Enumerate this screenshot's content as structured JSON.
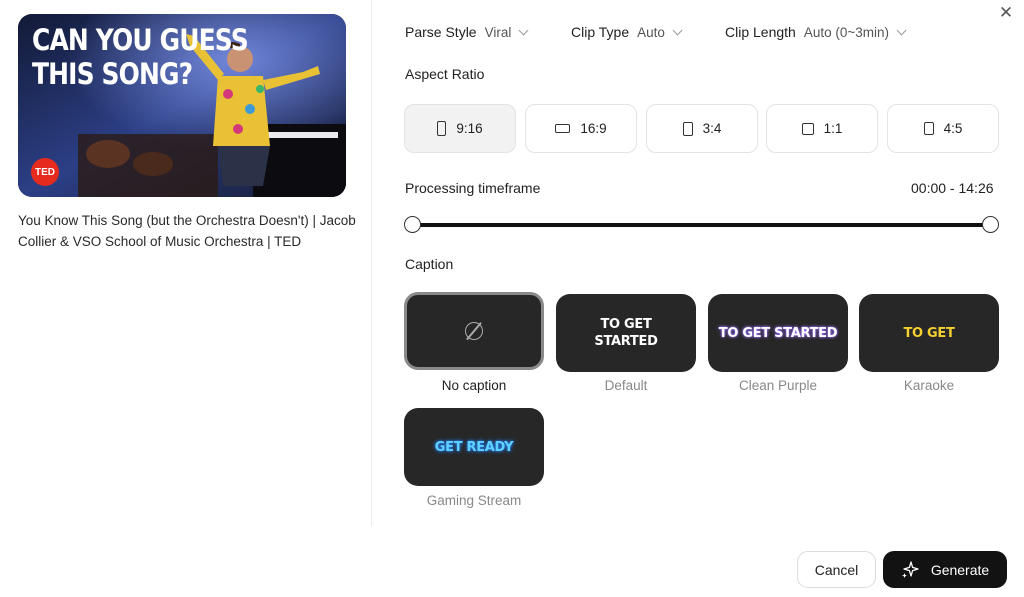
{
  "video": {
    "thumbnail_line1": "CAN YOU GUESS",
    "thumbnail_line2": "THIS SONG?",
    "badge": "TED",
    "title": "You Know This Song (but the Orchestra Doesn't) | Jacob Collier & VSO School of Music Orchestra | TED"
  },
  "params": {
    "parse_style": {
      "label": "Parse Style",
      "value": "Viral"
    },
    "clip_type": {
      "label": "Clip Type",
      "value": "Auto"
    },
    "clip_length": {
      "label": "Clip Length",
      "value": "Auto (0~3min)"
    }
  },
  "aspect": {
    "label": "Aspect Ratio",
    "options": [
      {
        "label": "9:16",
        "selected": true
      },
      {
        "label": "16:9",
        "selected": false
      },
      {
        "label": "3:4",
        "selected": false
      },
      {
        "label": "1:1",
        "selected": false
      },
      {
        "label": "4:5",
        "selected": false
      }
    ]
  },
  "timeframe": {
    "label": "Processing timeframe",
    "range": "00:00 - 14:26",
    "start_fraction": 0,
    "end_fraction": 1
  },
  "caption": {
    "label": "Caption",
    "styles": [
      {
        "name": "No caption",
        "preview": "",
        "selected": true
      },
      {
        "name": "Default",
        "preview": "TO GET STARTED",
        "selected": false
      },
      {
        "name": "Clean Purple",
        "preview": "TO GET STARTED",
        "selected": false
      },
      {
        "name": "Karaoke",
        "preview": "TO GET",
        "selected": false
      },
      {
        "name": "Gaming Stream",
        "preview": "GET READY",
        "selected": false
      }
    ]
  },
  "actions": {
    "cancel": "Cancel",
    "generate": "Generate",
    "close_icon": "close-icon"
  },
  "colors": {
    "primary_button": "#121212",
    "karaoke_text": "#f5d030",
    "gaming_text": "#5fd3ff",
    "purple_glow": "#a37bff",
    "ted_red": "#e62b1e"
  }
}
